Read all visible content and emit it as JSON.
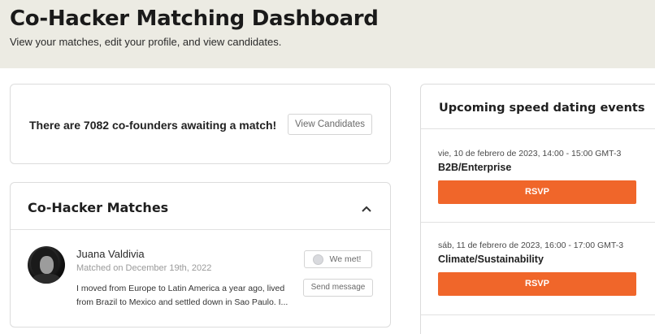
{
  "header": {
    "title": "Co-Hacker Matching Dashboard",
    "subtitle": "View your matches, edit your profile, and view candidates."
  },
  "awaiting": {
    "text": "There are 7082 co-founders awaiting a match!",
    "button_label": "View Candidates"
  },
  "matches": {
    "title": "Co-Hacker Matches",
    "collapse_icon": "chevron-up-icon",
    "items": [
      {
        "name": "Juana Valdivia",
        "matched_on": "Matched on December 19th, 2022",
        "bio": "I moved from Europe to Latin America a year ago, lived from Brazil to Mexico and settled down in Sao Paulo. I...",
        "we_met_label": "We met!",
        "send_label": "Send message"
      }
    ]
  },
  "events": {
    "title": "Upcoming speed dating events",
    "items": [
      {
        "date": "vie, 10 de febrero de 2023, 14:00 - 15:00 GMT-3",
        "name": "B2B/Enterprise",
        "rsvp_label": "RSVP"
      },
      {
        "date": "sáb, 11 de febrero de 2023, 16:00 - 17:00 GMT-3",
        "name": "Climate/Sustainability",
        "rsvp_label": "RSVP"
      }
    ]
  },
  "colors": {
    "header_bg": "#ecebe3",
    "accent": "#f0662a"
  }
}
